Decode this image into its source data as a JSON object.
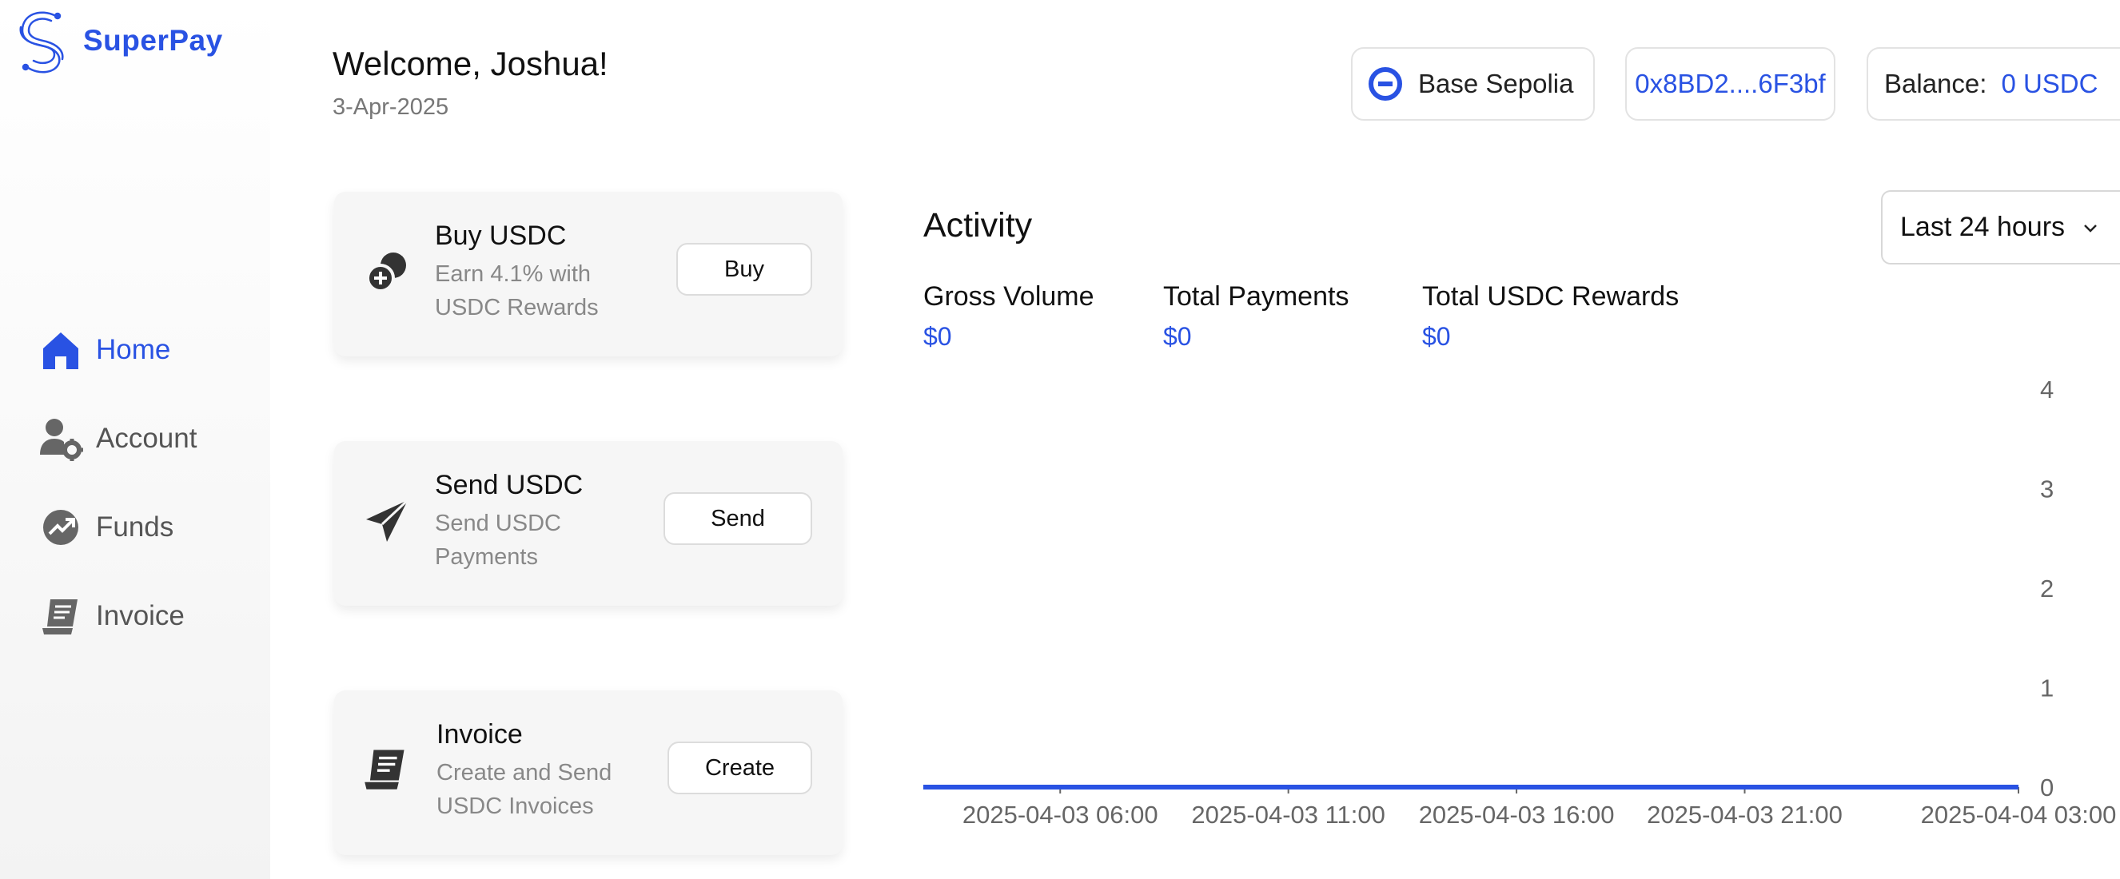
{
  "app": {
    "name": "SuperPay"
  },
  "sidebar": {
    "items": [
      {
        "label": "Home",
        "icon": "home-icon",
        "active": true
      },
      {
        "label": "Account",
        "icon": "user-gear-icon",
        "active": false
      },
      {
        "label": "Funds",
        "icon": "trend-up-icon",
        "active": false
      },
      {
        "label": "Invoice",
        "icon": "receipt-icon",
        "active": false
      }
    ]
  },
  "header": {
    "welcome": "Welcome, Joshua!",
    "date": "3-Apr-2025",
    "network": "Base Sepolia",
    "address": "0x8BD2....6F3bf",
    "balance_label": "Balance:",
    "balance_value": "0 USDC"
  },
  "cards": [
    {
      "title": "Buy USDC",
      "desc": "Earn 4.1% with USDC Rewards",
      "button": "Buy",
      "icon": "coins-icon"
    },
    {
      "title": "Send USDC",
      "desc": "Send USDC Payments",
      "button": "Send",
      "icon": "paper-plane-icon"
    },
    {
      "title": "Invoice",
      "desc": "Create and Send USDC Invoices",
      "button": "Create",
      "icon": "receipt-icon"
    }
  ],
  "activity": {
    "title": "Activity",
    "range": "Last 24 hours",
    "stats": [
      {
        "label": "Gross Volume",
        "value": "$0"
      },
      {
        "label": "Total Payments",
        "value": "$0"
      },
      {
        "label": "Total USDC Rewards",
        "value": "$0"
      }
    ]
  },
  "colors": {
    "accent": "#2952e3",
    "muted": "#888888"
  },
  "chart_data": {
    "type": "line",
    "title": "",
    "xlabel": "",
    "ylabel": "",
    "x": [
      "2025-04-03 03:00",
      "2025-04-04 03:00"
    ],
    "series": [
      {
        "values": [
          0,
          0
        ]
      }
    ],
    "xticks": [
      "2025-04-03 06:00",
      "2025-04-03 11:00",
      "2025-04-03 16:00",
      "2025-04-03 21:00",
      "2025-04-04 03:00"
    ],
    "yticks": [
      0,
      1,
      2,
      3,
      4
    ],
    "ylim": [
      0,
      4
    ],
    "grid": false,
    "y_axis_side": "right"
  }
}
